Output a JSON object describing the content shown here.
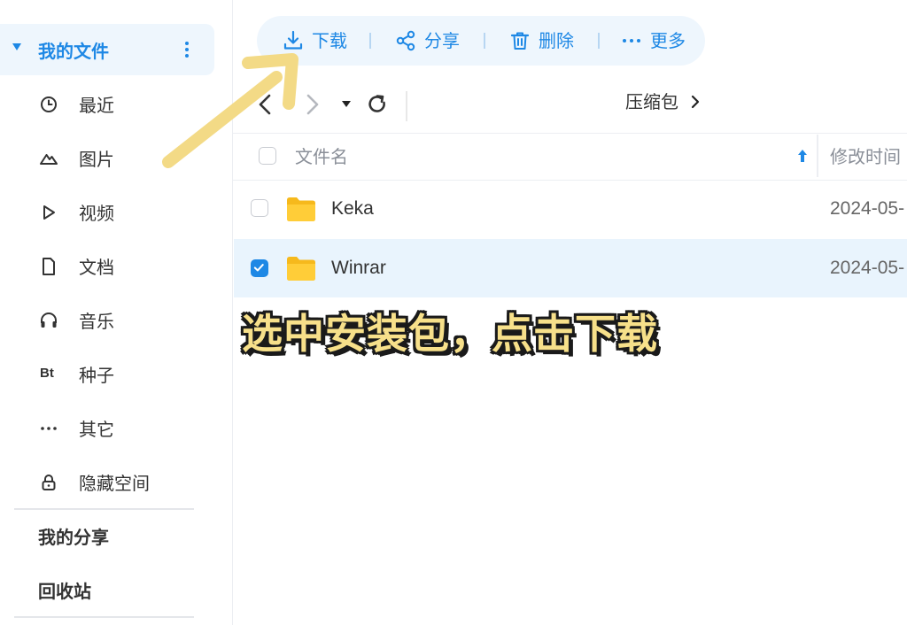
{
  "sidebar": {
    "my_files": "我的文件",
    "items": [
      {
        "label": "最近",
        "icon": "clock-icon"
      },
      {
        "label": "图片",
        "icon": "mountain-icon"
      },
      {
        "label": "视频",
        "icon": "play-icon"
      },
      {
        "label": "文档",
        "icon": "document-icon"
      },
      {
        "label": "音乐",
        "icon": "headphones-icon"
      },
      {
        "label": "种子",
        "icon": "bt-icon",
        "icon_text": "Bt"
      },
      {
        "label": "其它",
        "icon": "more-icon"
      },
      {
        "label": "隐藏空间",
        "icon": "lock-icon"
      }
    ],
    "my_share": "我的分享",
    "recycle_bin": "回收站"
  },
  "toolbar": {
    "download": "下载",
    "share": "分享",
    "delete": "删除",
    "more": "更多"
  },
  "breadcrumb": {
    "current": "压缩包"
  },
  "file_list": {
    "columns": {
      "name": "文件名",
      "modified": "修改时间"
    },
    "rows": [
      {
        "name": "Keka",
        "modified": "2024-05-",
        "checked": false
      },
      {
        "name": "Winrar",
        "modified": "2024-05-",
        "checked": true
      }
    ]
  },
  "overlay": {
    "caption": "选中安装包，点击下载"
  },
  "colors": {
    "accent": "#1e88e5",
    "highlight": "#eef6fd",
    "folder": "#fbc02d",
    "caption_fill": "#f7e08a",
    "caption_outline": "#1a1a1a"
  }
}
